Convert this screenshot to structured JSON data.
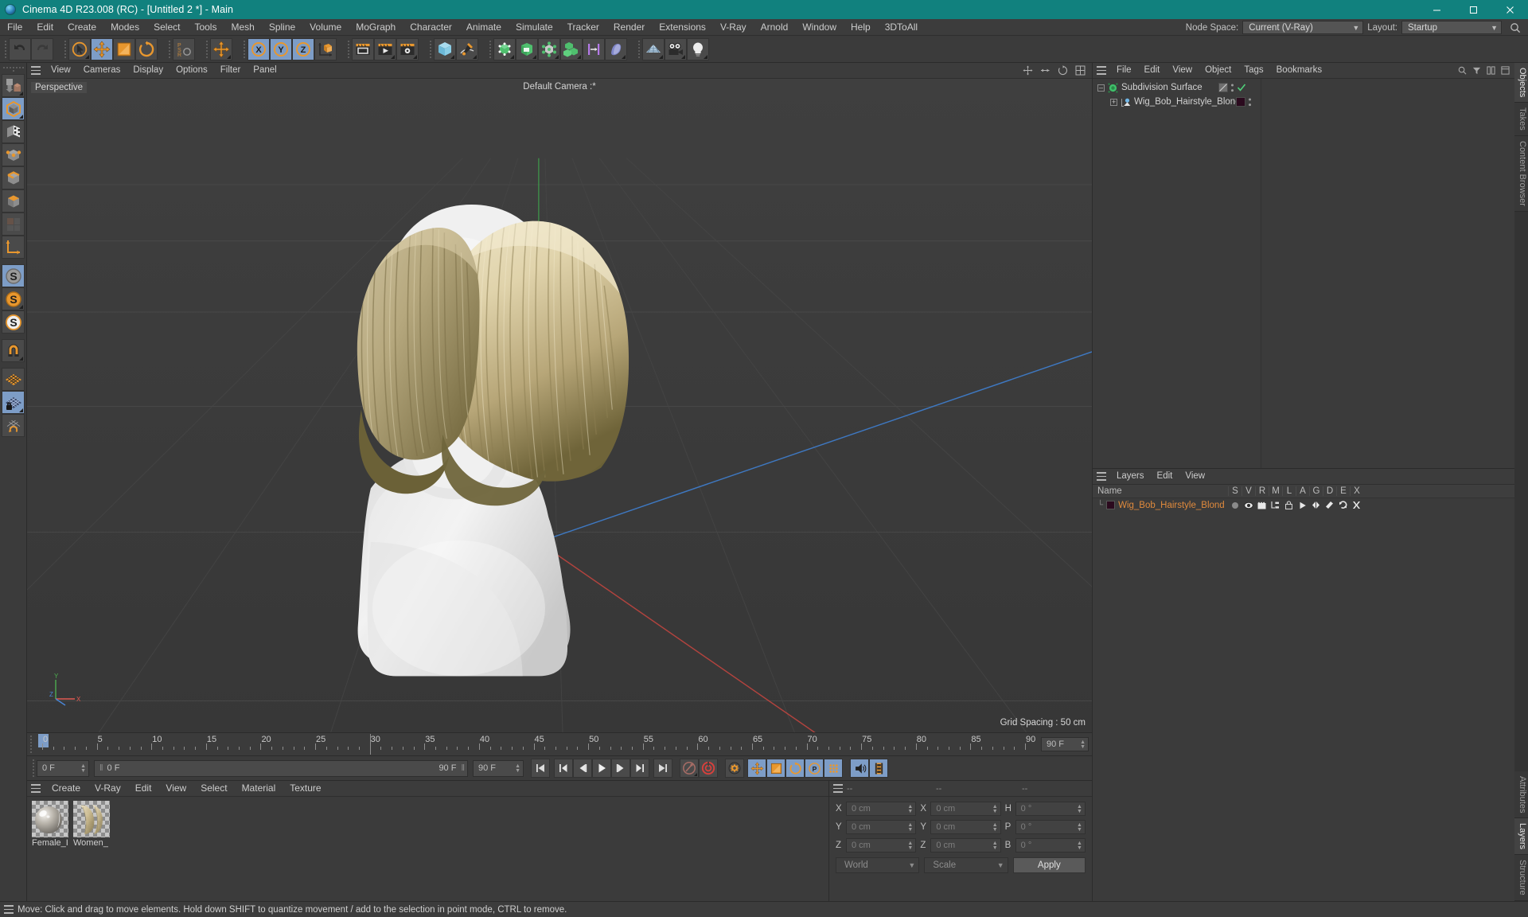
{
  "window": {
    "title": "Cinema 4D R23.008 (RC) - [Untitled 2 *] - Main",
    "minimize": "–",
    "maximize": "❐",
    "close": "✕"
  },
  "menubar": {
    "items": [
      "File",
      "Edit",
      "Create",
      "Modes",
      "Select",
      "Tools",
      "Mesh",
      "Spline",
      "Volume",
      "MoGraph",
      "Character",
      "Animate",
      "Simulate",
      "Tracker",
      "Render",
      "Extensions",
      "V-Ray",
      "Arnold",
      "Window",
      "Help",
      "3DToAll"
    ],
    "node_space_label": "Node Space:",
    "node_space_value": "Current (V-Ray)",
    "layout_label": "Layout:",
    "layout_value": "Startup",
    "search_icon": "search-icon"
  },
  "toolbar": {
    "groups": [
      {
        "name": "history",
        "buttons": [
          {
            "name": "undo-button",
            "icon": "undo-icon",
            "active": false
          },
          {
            "name": "redo-button",
            "icon": "redo-icon",
            "active": false
          }
        ]
      },
      {
        "name": "transform",
        "buttons": [
          {
            "name": "live-selection-button",
            "icon": "live-selection-icon",
            "active": false,
            "corner": true
          },
          {
            "name": "move-button",
            "icon": "move-icon",
            "active": true
          },
          {
            "name": "scale-button",
            "icon": "scale-icon",
            "active": false
          },
          {
            "name": "rotate-button",
            "icon": "rotate-icon",
            "active": false
          }
        ]
      },
      {
        "name": "psr",
        "buttons": [
          {
            "name": "psr-lock-button",
            "icon": "psr-icon",
            "active": false
          }
        ]
      },
      {
        "name": "axis",
        "buttons": [
          {
            "name": "world-object-axis-button",
            "icon": "move-icon",
            "active": false,
            "corner": true
          }
        ]
      },
      {
        "name": "axislock",
        "buttons": [
          {
            "name": "lock-x-button",
            "icon": "axis-x-icon",
            "active": true
          },
          {
            "name": "lock-y-button",
            "icon": "axis-y-icon",
            "active": true
          },
          {
            "name": "lock-z-button",
            "icon": "axis-z-icon",
            "active": true
          },
          {
            "name": "coordinate-system-button",
            "icon": "coord-system-icon",
            "active": false
          }
        ]
      },
      {
        "name": "render",
        "buttons": [
          {
            "name": "render-view-button",
            "icon": "render-view-icon",
            "active": false
          },
          {
            "name": "render-to-picture-viewer-button",
            "icon": "render-picture-icon",
            "active": false,
            "corner": true
          },
          {
            "name": "render-settings-button",
            "icon": "render-settings-icon",
            "active": false,
            "corner": true
          }
        ]
      },
      {
        "name": "create",
        "buttons": [
          {
            "name": "add-cube-button",
            "icon": "cube-icon",
            "active": false,
            "corner": true
          },
          {
            "name": "add-spline-button",
            "icon": "pen-spline-icon",
            "active": false,
            "corner": true
          }
        ]
      },
      {
        "name": "generators",
        "buttons": [
          {
            "name": "add-generator-button",
            "icon": "hyper-nurbs-icon",
            "active": false,
            "corner": true
          },
          {
            "name": "add-array-button",
            "icon": "array-icon",
            "active": false,
            "corner": true
          },
          {
            "name": "add-deformer-button",
            "icon": "deformer-icon",
            "active": false,
            "corner": true
          },
          {
            "name": "add-mograph-button",
            "icon": "mograph-cloner-icon",
            "active": false,
            "corner": true
          },
          {
            "name": "add-field-button",
            "icon": "field-icon",
            "active": false
          },
          {
            "name": "add-character-button",
            "icon": "character-icon",
            "active": false,
            "corner": true
          }
        ]
      },
      {
        "name": "scene",
        "buttons": [
          {
            "name": "add-floor-button",
            "icon": "floor-icon",
            "active": false,
            "corner": true
          },
          {
            "name": "add-camera-button",
            "icon": "camera-icon",
            "active": false,
            "corner": true
          },
          {
            "name": "add-light-button",
            "icon": "light-bulb-icon",
            "active": false,
            "corner": true
          }
        ]
      }
    ]
  },
  "lefttools": {
    "buttons": [
      {
        "name": "make-editable-button",
        "icon": "make-editable-icon",
        "active": false,
        "corner": true
      },
      {
        "name": "model-mode-button",
        "icon": "model-mode-icon",
        "active": true,
        "corner": true
      },
      {
        "name": "texture-mode-button",
        "icon": "texture-mode-icon",
        "active": false
      },
      {
        "name": "point-mode-button",
        "icon": "point-mode-icon",
        "active": false
      },
      {
        "name": "edge-mode-button",
        "icon": "edge-mode-icon",
        "active": false
      },
      {
        "name": "polygon-mode-button",
        "icon": "polygon-mode-icon",
        "active": false
      },
      {
        "name": "uv-mode-button",
        "icon": "uv-mode-icon",
        "active": false
      },
      {
        "name": "axis-mode-button",
        "icon": "axis-mode-icon",
        "active": false
      },
      {
        "name": "enable-axis-button",
        "icon": "s-gray-icon",
        "active": true
      },
      {
        "name": "viewport-solo-single-button",
        "icon": "s-orange-icon",
        "active": false,
        "corner": true
      },
      {
        "name": "viewport-solo-hierarchy-button",
        "icon": "s-outline-icon",
        "active": false
      },
      {
        "name": "snap-button",
        "icon": "magnet-icon",
        "active": false,
        "corner": true
      },
      {
        "name": "workplane-button",
        "icon": "workplane-icon",
        "active": false
      },
      {
        "name": "lock-workplane-button",
        "icon": "workplane-lock-icon",
        "active": true,
        "corner": true
      },
      {
        "name": "planar-workplane-button",
        "icon": "workplane-rotate-icon",
        "active": false
      }
    ]
  },
  "viewport": {
    "menu_items": [
      "View",
      "Cameras",
      "Display",
      "Options",
      "Filter",
      "Panel"
    ],
    "label": "Perspective",
    "camera": "Default Camera :*",
    "grid_spacing": "Grid Spacing : 50 cm",
    "axis_labels": {
      "x": "X",
      "y": "Y",
      "z": "Z"
    }
  },
  "timeline": {
    "ticks": [
      0,
      5,
      10,
      15,
      20,
      25,
      30,
      35,
      40,
      45,
      50,
      55,
      60,
      65,
      70,
      75,
      80,
      85,
      90
    ],
    "current_frame_marker": 0,
    "playhead_frame": 30,
    "end_field": "0 F",
    "current_frame_field": "0 F",
    "preview_start": "0 F",
    "preview_end": "90 F",
    "doc_end": "90 F"
  },
  "animbar": {
    "buttons": [
      {
        "name": "go-to-start-button",
        "icon": "skip-start-icon",
        "active": false
      },
      {
        "name": "go-to-previous-key-button",
        "icon": "prev-key-icon",
        "active": false
      },
      {
        "name": "go-to-previous-frame-button",
        "icon": "step-back-icon",
        "active": false
      },
      {
        "name": "play-button",
        "icon": "play-icon",
        "active": false
      },
      {
        "name": "go-to-next-frame-button",
        "icon": "step-forward-icon",
        "active": false
      },
      {
        "name": "go-to-next-key-button",
        "icon": "next-key-icon",
        "active": false
      },
      {
        "name": "go-to-end-button",
        "icon": "skip-end-icon",
        "active": false
      },
      {
        "name": "record-active-objects-button",
        "icon": "record-key-icon",
        "active": false,
        "corner": true
      },
      {
        "name": "autokeying-button",
        "icon": "autokey-icon",
        "active": false
      },
      {
        "name": "keyframe-selection-button",
        "icon": "key-settings-icon",
        "active": false
      },
      {
        "name": "position-key-button",
        "icon": "move-icon",
        "active": true
      },
      {
        "name": "scale-key-button",
        "icon": "scale-icon",
        "active": true
      },
      {
        "name": "rotation-key-button",
        "icon": "rotate-icon",
        "active": true
      },
      {
        "name": "parameter-key-button",
        "icon": "param-key-icon",
        "active": true
      },
      {
        "name": "point-level-animation-button",
        "icon": "pla-icon",
        "active": true
      },
      {
        "name": "play-sound-button",
        "icon": "sound-icon",
        "active": true
      },
      {
        "name": "timeline-filmstrip-button",
        "icon": "filmstrip-icon",
        "active": true
      }
    ]
  },
  "material_manager": {
    "menu_items": [
      "Create",
      "V-Ray",
      "Edit",
      "View",
      "Select",
      "Material",
      "Texture"
    ],
    "materials": [
      {
        "name": "Female_I",
        "type": "sphere-preview"
      },
      {
        "name": "Women_",
        "type": "hair-preview"
      }
    ]
  },
  "coordinates": {
    "header": [
      "--",
      "--",
      "--"
    ],
    "position": {
      "x": "0 cm",
      "y": "0 cm",
      "z": "0 cm"
    },
    "size": {
      "x": "0 cm",
      "y": "0 cm",
      "z": "0 cm"
    },
    "rotation": {
      "h": "0 °",
      "p": "0 °",
      "b": "0 °"
    },
    "labels": {
      "px": "X",
      "py": "Y",
      "pz": "Z",
      "sx": "X",
      "sy": "Y",
      "sz": "Z",
      "rh": "H",
      "rp": "P",
      "rb": "B"
    },
    "coord_system": "World",
    "mode": "Scale",
    "apply": "Apply"
  },
  "object_manager": {
    "menu_items": [
      "File",
      "Edit",
      "View",
      "Object",
      "Tags",
      "Bookmarks"
    ],
    "rows": [
      {
        "name": "Subdivision Surface",
        "indent": 0,
        "icon": "subdivision-surface-icon",
        "tag_color": "#6e6e6e",
        "has_check": true
      },
      {
        "name": "Wig_Bob_Hairstyle_Blond",
        "indent": 1,
        "icon": "polygon-object-icon",
        "tag_color": "#2b0a1e",
        "has_check": false
      }
    ]
  },
  "layer_manager": {
    "menu_items": [
      "Layers",
      "Edit",
      "View"
    ],
    "columns": [
      "Name",
      "S",
      "V",
      "R",
      "M",
      "L",
      "A",
      "G",
      "D",
      "E",
      "X"
    ],
    "rows": [
      {
        "name": "Wig_Bob_Hairstyle_Blond",
        "color": "#2b0a1e"
      }
    ]
  },
  "right_tabs": {
    "top": [
      "Objects",
      "Takes",
      "Content Browser"
    ],
    "bottom": [
      "Attributes",
      "Layers",
      "Structure"
    ],
    "active_top": "Objects",
    "active_bottom": "Layers"
  },
  "statusbar": {
    "message": "Move: Click and drag to move elements. Hold down SHIFT to quantize movement / add to the selection in point mode, CTRL to remove."
  },
  "colors": {
    "title_bar": "#11817e",
    "accent_blue": "#7d9dc7",
    "orange": "#e08a3c",
    "panel_bg": "#3b3b3b",
    "text": "#c8c8c8"
  }
}
